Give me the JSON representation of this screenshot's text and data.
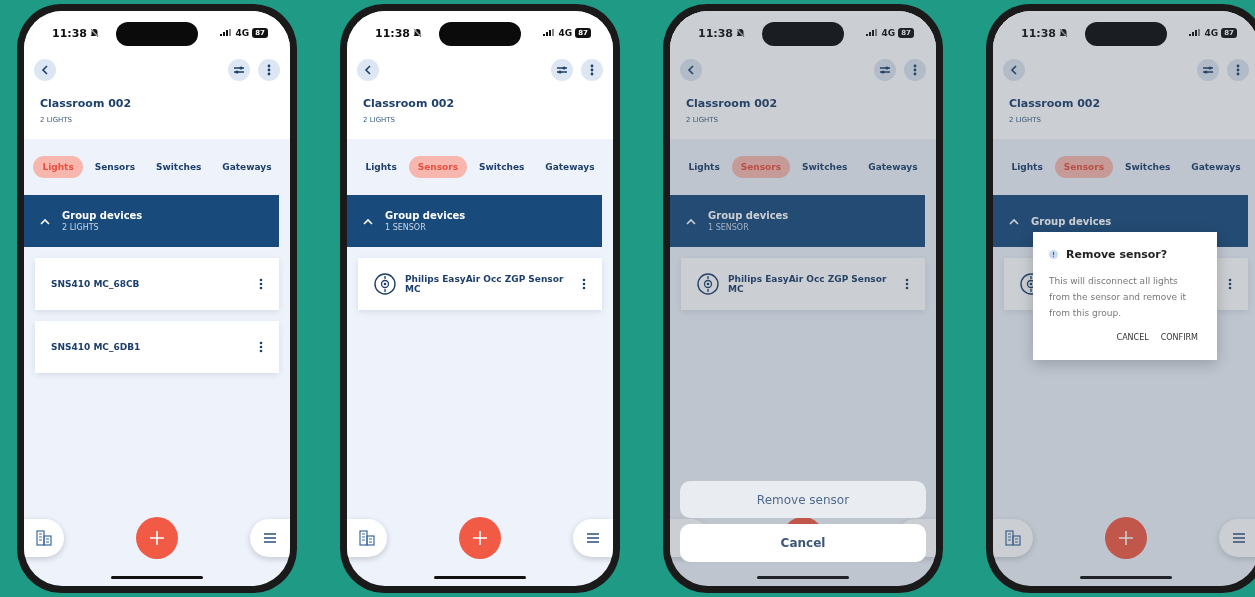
{
  "phones": [
    {
      "status_bar": {
        "time": "11:38",
        "network": "4G",
        "battery": "87"
      },
      "title": "Classroom 002",
      "subtitle": "2 LIGHTS",
      "tabs": [
        {
          "label": "Lights",
          "selected": true
        },
        {
          "label": "Sensors",
          "selected": false
        },
        {
          "label": "Switches",
          "selected": false
        },
        {
          "label": "Gateways",
          "selected": false
        }
      ],
      "group": {
        "title": "Group devices",
        "subtitle": "2 LIGHTS",
        "expanded": true
      },
      "devices": [
        {
          "kind": "light",
          "name": "SNS410 MC_68CB"
        },
        {
          "kind": "light",
          "name": "SNS410 MC_6DB1"
        }
      ]
    },
    {
      "status_bar": {
        "time": "11:38",
        "network": "4G",
        "battery": "87"
      },
      "title": "Classroom 002",
      "subtitle": "2 LIGHTS",
      "tabs": [
        {
          "label": "Lights",
          "selected": false
        },
        {
          "label": "Sensors",
          "selected": true
        },
        {
          "label": "Switches",
          "selected": false
        },
        {
          "label": "Gateways",
          "selected": false
        }
      ],
      "group": {
        "title": "Group devices",
        "subtitle": "1 SENSOR",
        "expanded": true
      },
      "devices": [
        {
          "kind": "sensor",
          "name": "Philips EasyAir Occ ZGP Sensor MC"
        }
      ]
    },
    {
      "status_bar": {
        "time": "11:38",
        "network": "4G",
        "battery": "87"
      },
      "title": "Classroom 002",
      "subtitle": "2 LIGHTS",
      "tabs": [
        {
          "label": "Lights",
          "selected": false
        },
        {
          "label": "Sensors",
          "selected": true
        },
        {
          "label": "Switches",
          "selected": false
        },
        {
          "label": "Gateways",
          "selected": false
        }
      ],
      "group": {
        "title": "Group devices",
        "subtitle": "1 SENSOR",
        "expanded": true
      },
      "devices": [
        {
          "kind": "sensor",
          "name": "Philips EasyAir Occ ZGP Sensor MC"
        }
      ],
      "overlay": {
        "kind": "action_sheet",
        "actions": [
          "Remove sensor"
        ],
        "cancel": "Cancel"
      }
    },
    {
      "status_bar": {
        "time": "11:38",
        "network": "4G",
        "battery": "87"
      },
      "title": "Classroom 002",
      "subtitle": "2 LIGHTS",
      "tabs": [
        {
          "label": "Lights",
          "selected": false
        },
        {
          "label": "Sensors",
          "selected": true
        },
        {
          "label": "Switches",
          "selected": false
        },
        {
          "label": "Gateways",
          "selected": false
        }
      ],
      "group": {
        "title": "Group devices",
        "expanded": true
      },
      "devices": [
        {
          "kind": "sensor"
        }
      ],
      "overlay": {
        "kind": "dialog",
        "title": "Remove sensor?",
        "message": "This will disconnect all lights from the sensor and remove it from this group.",
        "buttons": [
          "CANCEL",
          "CONFIRM"
        ]
      }
    }
  ]
}
